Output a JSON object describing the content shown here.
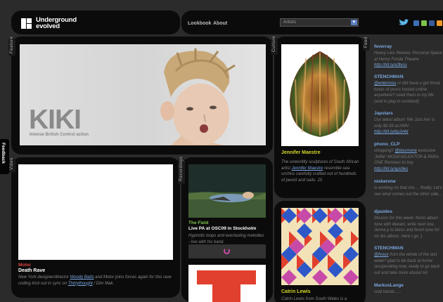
{
  "header": {
    "logo_line1": "Underground",
    "logo_line2": "evolved",
    "nav": [
      "Lookbook",
      "About"
    ],
    "artists_select": "Artists"
  },
  "tabs": {
    "feature": "Feature",
    "culture": "Culture",
    "feed": "Feed",
    "video": "Video",
    "recordings": "Recordings",
    "feedback": "Feedback"
  },
  "hero": {
    "title": "KIKI",
    "subtitle": "Intense British Control action"
  },
  "culture": [
    {
      "title": "Jennifer Maestre",
      "text_before": "The unworldly sculptures of South African artist ",
      "link": "Jennifer Maestre",
      "text_after": " resemble sea urchins carefully crafted out of hundreds of pencil and nails. JS"
    },
    {
      "title": "Catrin Lewis",
      "text": "Catrin Lewis from South Wales is a"
    }
  ],
  "video": {
    "tag": "Motor",
    "title": "Death Rave",
    "text_before": "New York designer/director ",
    "link1": "Woody Batts",
    "text_mid": " and Motor joins forces again for this rave coding trick out in sync on ",
    "link2": "Thirtythought",
    "text_after": " / Dim Mak."
  },
  "recording": {
    "tag": "The Field",
    "title": "Live PA at OSC09 in Stockholm",
    "text": "Hypnotic loops and everlasting melodies - live with his band."
  },
  "feed": [
    {
      "name": "feverray",
      "text": "Heavy Lies Review: Personal Space at Henry Fonda Theatre ",
      "link": "http://bit.ly/a3bciu"
    },
    {
      "name": "STENCHMAN",
      "link_before": "@entermou",
      "text": " or did have u got those tunes of yours hosted online anywhere? need them in my life (and to play in scotland)"
    },
    {
      "name": "Japstars",
      "text": "Our latest album 'We Just Are' is only $6.99 at HMV: ",
      "link": "http://bit.ly/bpJv4d"
    },
    {
      "name": "phono_CLP",
      "text": "shopping!! ",
      "link_before": "@bournone",
      "text2": " exclusive 'Jeffer' MODESELEKTOR & PARA ONE Remixes to buy ",
      "link": "http://bit.ly/aps9es"
    },
    {
      "name": "niskerone",
      "text": "is working on that mix.... finally. Let's see what comes out the other side..."
    },
    {
      "name": "djasides",
      "text": "Mission for this week: finish album tune with deeam, write next one, Jenna p to bless and finish tune for mr drs album. Here I go :)"
    },
    {
      "name": "STENCHMAN",
      "link_before": "@fvoux",
      "text": " from the whole of the last week? glad to be back at home recuperating now, ready to go back out and take more abuse! lol"
    },
    {
      "name": "MarkusLange",
      "text": "cold hands......"
    }
  ],
  "colors": {
    "accent_blue": "#7aa7e0",
    "accent_yellow": "#d6d62b",
    "accent_red": "#e04040",
    "accent_green": "#7ec44a",
    "panel_bg": "#0b0b0b",
    "page_bg": "#2b2b2b"
  }
}
